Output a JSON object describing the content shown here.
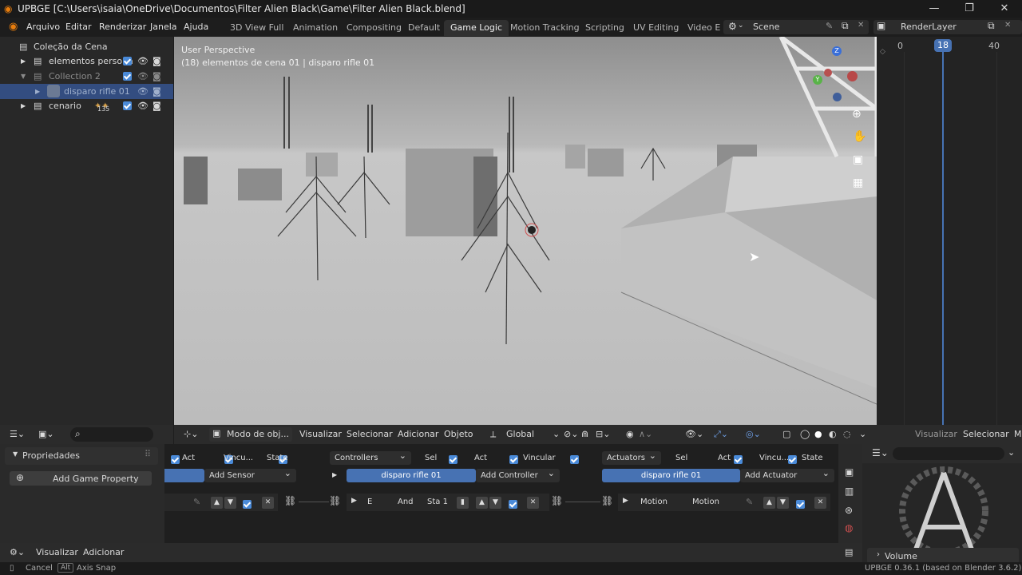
{
  "window": {
    "title": "UPBGE [C:\\Users\\isaia\\OneDrive\\Documentos\\Filter Alien Black\\Game\\Filter Alien Black.blend]",
    "minimize": "—",
    "maximize": "❐",
    "close": "✕"
  },
  "menu": [
    "Arquivo",
    "Editar",
    "Renderizar",
    "Janela",
    "Ajuda"
  ],
  "workspaces": [
    "3D View Full",
    "Animation",
    "Compositing",
    "Default",
    "Game Logic",
    "Motion Tracking",
    "Scripting",
    "UV Editing",
    "Video E"
  ],
  "active_workspace": "Game Logic",
  "scene": "Scene",
  "render_layer": "RenderLayer",
  "outliner": {
    "root": "Coleção da Cena",
    "items": [
      {
        "label": "elementos persona"
      },
      {
        "label": "Collection 2"
      },
      {
        "label": "disparo rifle 01"
      },
      {
        "label": "cenario",
        "badge": "135"
      }
    ]
  },
  "viewport": {
    "perspective": "User Perspective",
    "info": "(18) elementos de cena 01 | disparo rifle 01",
    "gizmo": {
      "z": "Z",
      "y": "Y"
    }
  },
  "timeline": {
    "ticks": [
      "0",
      "18",
      "40"
    ],
    "current": "18"
  },
  "viewport_header": {
    "mode": "Modo de obj...",
    "menus": [
      "Visualizar",
      "Selecionar",
      "Adicionar",
      "Objeto"
    ],
    "orientation": "Global"
  },
  "right_header": {
    "label1": "Visualizar",
    "label2": "Selecionar",
    "label3": "M"
  },
  "properties": {
    "title": "Propriedades",
    "add_game_property": "Add Game Property"
  },
  "logic": {
    "sensors": {
      "act": "Act",
      "link": "Vincu...",
      "state": "State",
      "add": "Add Sensor"
    },
    "controllers": {
      "dropdown": "Controllers",
      "sel": "Sel",
      "act": "Act",
      "link": "Vincular",
      "object": "disparo rifle 01",
      "add": "Add Controller",
      "row_name": "E",
      "row_type": "And",
      "row_state": "Sta 1"
    },
    "actuators": {
      "dropdown": "Actuators",
      "sel": "Sel",
      "act": "Act",
      "link": "Vincu...",
      "state": "State",
      "object": "disparo rifle 01",
      "add": "Add Actuator",
      "row_name": "Motion",
      "row_type": "Motion"
    }
  },
  "bottom": {
    "visualizar": "Visualizar",
    "adicionar": "Adicionar",
    "volume": "Volume"
  },
  "status": {
    "cancel": "Cancel",
    "alt_key": "Alt",
    "axis_snap": "Axis Snap",
    "version": "UPBGE 0.36.1 (based on Blender 3.6.2)"
  },
  "colors": {
    "accent": "#4772b3",
    "selected_row": "#334d80",
    "checkbox": "#4a8ad8",
    "timeline_cursor": "#4772b3"
  }
}
